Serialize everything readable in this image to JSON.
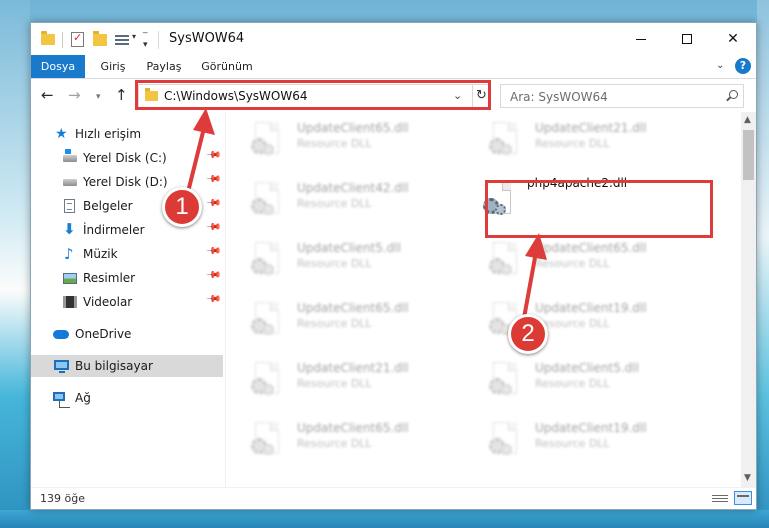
{
  "window": {
    "title": "SysWOW64"
  },
  "ribbon": {
    "tabs": [
      "Dosya",
      "Giriş",
      "Paylaş",
      "Görünüm"
    ],
    "help": "?"
  },
  "nav": {
    "address": "C:\\Windows\\SysWOW64",
    "search_placeholder": "Ara: SysWOW64"
  },
  "sidebar": {
    "items": [
      {
        "label": "Hızlı erişim",
        "icon": "star-icon"
      },
      {
        "label": "Yerel Disk (C:)",
        "icon": "drive-icon",
        "pinned": true
      },
      {
        "label": "Yerel Disk (D:)",
        "icon": "drive-icon",
        "pinned": true
      },
      {
        "label": "Belgeler",
        "icon": "documents-icon",
        "pinned": true
      },
      {
        "label": "İndirmeler",
        "icon": "download-icon",
        "pinned": true
      },
      {
        "label": "Müzik",
        "icon": "music-icon",
        "pinned": true
      },
      {
        "label": "Resimler",
        "icon": "pictures-icon",
        "pinned": true
      },
      {
        "label": "Videolar",
        "icon": "videos-icon",
        "pinned": true
      },
      {
        "label": "OneDrive",
        "icon": "cloud-icon"
      },
      {
        "label": "Bu bilgisayar",
        "icon": "computer-icon",
        "selected": true
      },
      {
        "label": "Ağ",
        "icon": "network-icon"
      }
    ]
  },
  "files": [
    {
      "name": "UpdateClient65.dll",
      "desc": "Resource DLL"
    },
    {
      "name": "UpdateClient21.dll",
      "desc": "Resource DLL"
    },
    {
      "name": "UpdateClient42.dll",
      "desc": "Resource DLL"
    },
    {
      "name": "php4apache2.dll",
      "desc": ""
    },
    {
      "name": "UpdateClient5.dll",
      "desc": "Resource DLL"
    },
    {
      "name": "UpdateClient65.dll",
      "desc": "Resource DLL"
    },
    {
      "name": "UpdateClient65.dll",
      "desc": "Resource DLL"
    },
    {
      "name": "UpdateClient19.dll",
      "desc": "Resource DLL"
    },
    {
      "name": "UpdateClient21.dll",
      "desc": "Resource DLL"
    },
    {
      "name": "UpdateClient5.dll",
      "desc": "Resource DLL"
    },
    {
      "name": "UpdateClient65.dll",
      "desc": "Resource DLL"
    },
    {
      "name": "UpdateClient19.dll",
      "desc": "Resource DLL"
    }
  ],
  "status": {
    "count": "139 öğe"
  },
  "annotations": {
    "step1": "1",
    "step2": "2",
    "color": "#de3b3b"
  }
}
